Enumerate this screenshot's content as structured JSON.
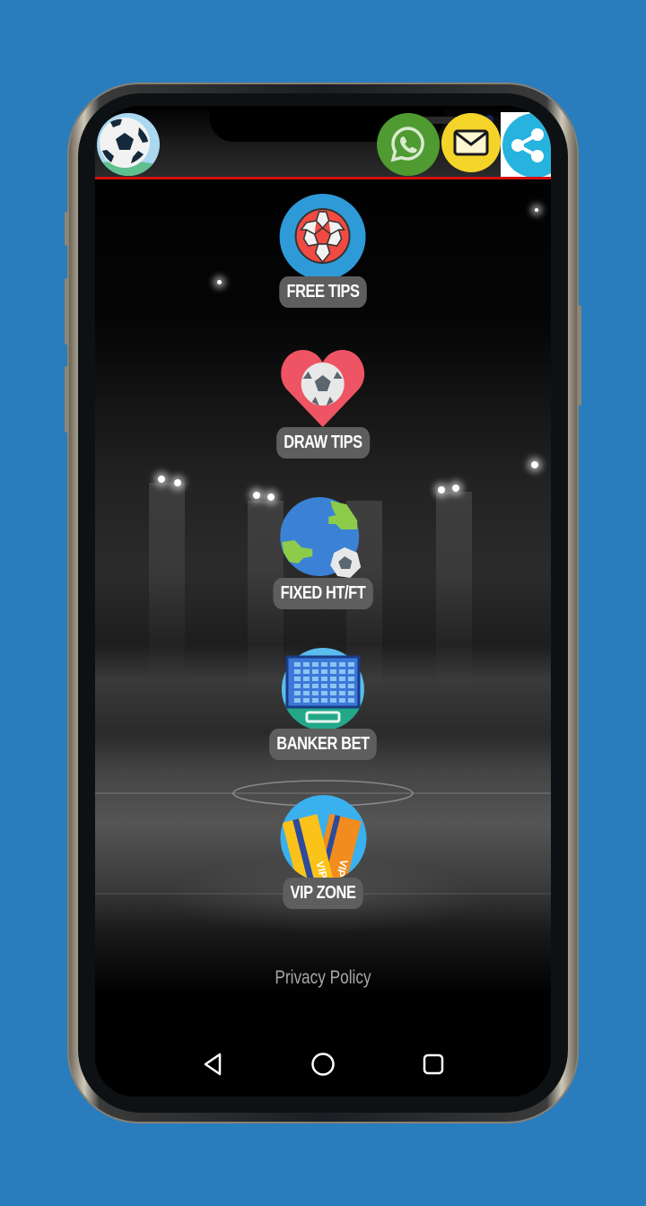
{
  "app": {
    "header": {
      "logo_icon": "soccer-ball-icon",
      "actions": [
        {
          "name": "whatsapp",
          "icon": "whatsapp-icon",
          "color": "#4caf3e"
        },
        {
          "name": "email",
          "icon": "mail-icon",
          "color": "#f5d42a"
        },
        {
          "name": "share",
          "icon": "share-icon",
          "color": "#26b3de"
        }
      ],
      "divider_color": "#d41010"
    },
    "menu": [
      {
        "label": "FREE TIPS",
        "icon": "soccer-ball-icon"
      },
      {
        "label": "DRAW TIPS",
        "icon": "heart-ball-icon"
      },
      {
        "label": "FIXED HT/FT",
        "icon": "globe-ball-icon"
      },
      {
        "label": "BANKER BET",
        "icon": "goal-net-icon"
      },
      {
        "label": "VIP ZONE",
        "icon": "vip-cards-icon"
      }
    ],
    "vip_card_text": "VIP",
    "footer": {
      "privacy_label": "Privacy Policy"
    },
    "navbar": {
      "back": "back-icon",
      "home": "home-icon",
      "recents": "recents-icon"
    }
  },
  "frame": {
    "background_color": "#2a7dbd"
  }
}
